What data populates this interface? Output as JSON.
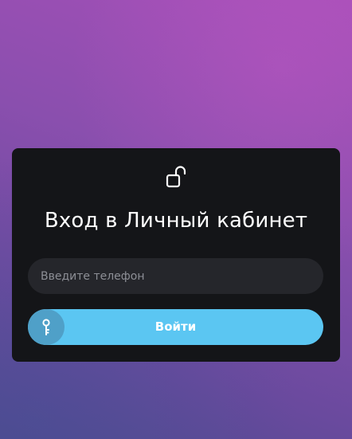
{
  "login": {
    "title": "Вход в Личный кабинет",
    "phone_placeholder": "Введите телефон",
    "phone_value": "",
    "submit_label": "Войти"
  },
  "icons": {
    "header": "unlock-icon",
    "submit": "key-icon"
  },
  "colors": {
    "card_background": "#141518",
    "input_background": "#25262b",
    "button_background": "#5bc6f2",
    "button_icon_badge": "#4fa0c8",
    "text": "#ffffff"
  }
}
